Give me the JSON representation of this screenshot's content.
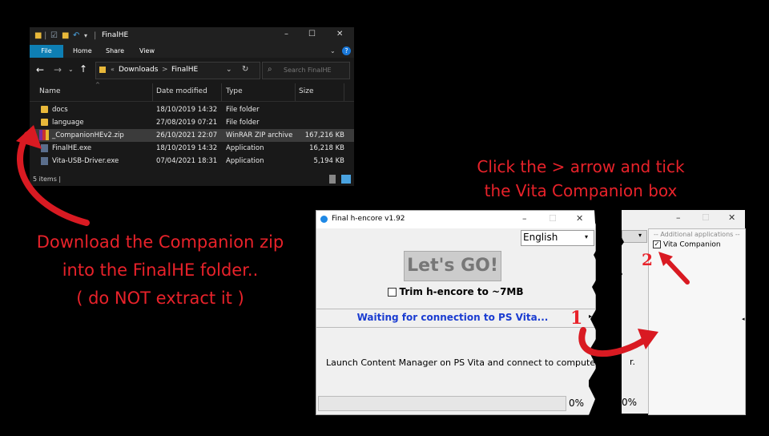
{
  "explorer": {
    "title": "FinalHE",
    "ribbon": {
      "file": "File",
      "home": "Home",
      "share": "Share",
      "view": "View"
    },
    "breadcrumb": {
      "prefix": "«",
      "downloads": "Downloads",
      "sep": ">",
      "folder": "FinalHE"
    },
    "search_placeholder": "Search FinalHE",
    "columns": {
      "name": "Name",
      "date": "Date modified",
      "type": "Type",
      "size": "Size"
    },
    "rows": [
      {
        "name": "docs",
        "date": "18/10/2019 14:32",
        "type": "File folder",
        "size": ""
      },
      {
        "name": "language",
        "date": "27/08/2019 07:21",
        "type": "File folder",
        "size": ""
      },
      {
        "name": "_CompanionHEv2.zip",
        "date": "26/10/2021 22:07",
        "type": "WinRAR ZIP archive",
        "size": "167,216 KB"
      },
      {
        "name": "FinalHE.exe",
        "date": "18/10/2019 14:32",
        "type": "Application",
        "size": "16,218 KB"
      },
      {
        "name": "Vita-USB-Driver.exe",
        "date": "07/04/2021 18:31",
        "type": "Application",
        "size": "5,194 KB"
      }
    ],
    "status": "5 items |"
  },
  "annotations": {
    "download_line1": "Download the Companion zip",
    "download_line2": "into the FinalHE folder..",
    "download_line3": "( do NOT extract it )",
    "click_line1": "Click the > arrow and tick",
    "click_line2": "the Vita Companion box",
    "marker1": "1",
    "marker2": "2"
  },
  "finalhe": {
    "title": "Final h-encore v1.92",
    "language": "English",
    "letsgo": "Let's GO!",
    "trim_label": "Trim h-encore to ~7MB",
    "waiting": "Waiting for connection to PS Vita...",
    "launch_msg": "Launch Content Manager on PS Vita and connect to computer.",
    "progress_pct": "0%",
    "progress_value": 0
  },
  "strip": {
    "group_legend": "-- Additional applications --",
    "vita_companion": "Vita Companion",
    "launch_tail": "r.",
    "progress_pct": "0%"
  },
  "colors": {
    "annotation_red": "#e8222a",
    "waiting_blue": "#1a3cd1",
    "explorer_bg": "#191919"
  }
}
